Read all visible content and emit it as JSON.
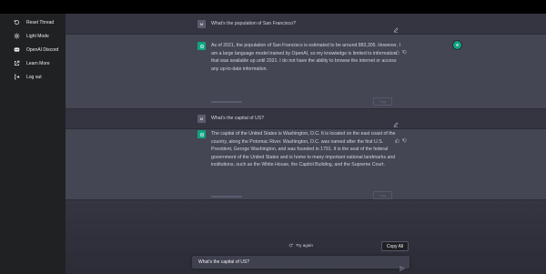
{
  "sidebar": {
    "items": [
      {
        "label": "Reset Thread",
        "icon": "reset-icon"
      },
      {
        "label": "Light Mode",
        "icon": "sun-icon"
      },
      {
        "label": "OpenAI Discord",
        "icon": "discord-icon"
      },
      {
        "label": "Learn More",
        "icon": "external-link-icon"
      },
      {
        "label": "Log out",
        "icon": "logout-icon"
      }
    ]
  },
  "thread": {
    "messages": [
      {
        "role": "user",
        "avatar": "M",
        "text": "What's the population of San Francisco?"
      },
      {
        "role": "assistant",
        "line1": "As of 2021, the population of San Francisco is estimated to be around 883,305. However, I",
        "line2": "am a large language model trained by OpenAI, so my knowledge is limited to information",
        "line3": "that was available up until 2021. I do not have the ability to browse the internet or access",
        "line4": "any up-to-date information.",
        "copy_label": "Copy"
      },
      {
        "role": "user",
        "avatar": "M",
        "text": "What's the capital of US?"
      },
      {
        "role": "assistant",
        "line1": "The capital of the United States is Washington, D.C. It is located on the east coast of the",
        "line2": "country, along the Potomac River. Washington, D.C. was named after the first U.S.",
        "line3": "President, George Washington, and was founded in 1791. It is the seat of the federal",
        "line4": "government of the United States and is home to many important national landmarks and",
        "line5": "institutions, such as the White House, the Capitol Building, and the Supreme Court.",
        "copy_label": "Copy"
      }
    ]
  },
  "actions": {
    "try_again_label": "Try again",
    "copy_all_label": "Copy All"
  },
  "composer": {
    "value": "What's the capital of US?"
  },
  "colors": {
    "sidebar_bg": "#202123",
    "main_bg": "#343541",
    "assistant_bg": "#444654",
    "accent": "#10a37f"
  }
}
